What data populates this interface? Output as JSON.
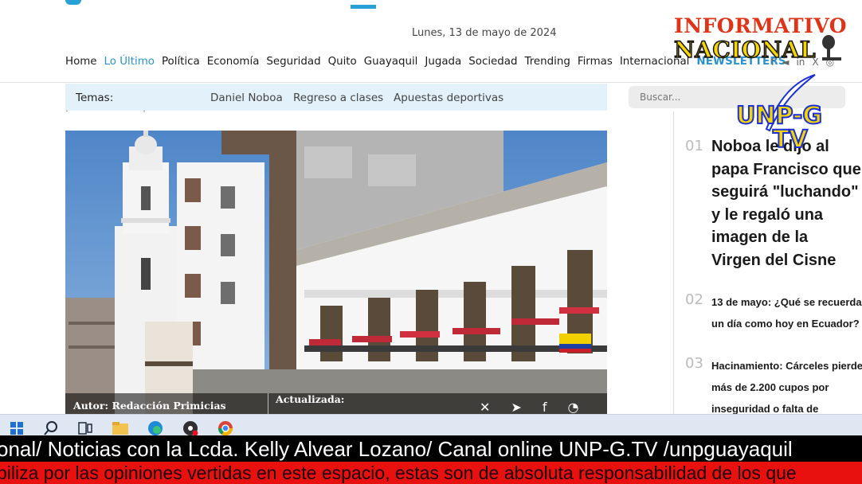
{
  "header": {
    "date": "Lunes, 13 de mayo de 2024"
  },
  "nav": {
    "items": [
      "Home",
      "Lo Último",
      "Política",
      "Economía",
      "Seguridad",
      "Quito",
      "Guayaquil",
      "Jugada",
      "Sociedad",
      "Trending",
      "Firmas",
      "Internacional"
    ],
    "active": "Lo Último",
    "newsletter": "NEWSLETTERS",
    "social_icons": [
      "f",
      "◄",
      "in",
      "X",
      "◎"
    ]
  },
  "temas": {
    "label": "Temas:",
    "links": [
      "Daniel Noboa",
      "Regreso a clases",
      "Apuestas deportivas"
    ]
  },
  "search": {
    "placeholder": "Buscar..."
  },
  "article": {
    "cut_text": "procesos independentistas en América del Sur",
    "author": "Autor: Redacción Primicias",
    "updated": "Actualizada:"
  },
  "sidebar": {
    "stories": [
      {
        "rank": "01",
        "text": "Noboa le dijo al\npapa Francisco que\nseguirá \"luchando\"\ny le regaló una\nimagen de la\nVirgen del Cisne"
      },
      {
        "rank": "02",
        "text": "13 de mayo: ¿Qué se recuerda\nun día como hoy en Ecuador?"
      },
      {
        "rank": "03",
        "text": "Hacinamiento: Cárceles pierden\nmás de 2.200 cupos por\ninseguridad o falta de"
      }
    ]
  },
  "overlay": {
    "brand_top": "INFORMATIVO",
    "brand_bottom": "NACIONAL",
    "channel_top": "UNP-G",
    "channel_bottom": "TV"
  },
  "ticker": {
    "line1": "onal/ Noticias con la Lcda. Kelly Alvear Lozano/ Canal online UNP-G.TV /unpguayaquil",
    "line2": "biliza por las opiniones vertidas en este espacio, estas son de absoluta responsabilidad de los que"
  },
  "taskbar": {
    "icons": [
      "windows-icon",
      "search-icon",
      "task-view-icon",
      "file-explorer-icon",
      "edge-icon",
      "obs-icon",
      "chrome-icon"
    ]
  },
  "colors": {
    "accent": "#2a93cf",
    "temas_bg": "#e3f1fa",
    "ticker_black": "#000000",
    "ticker_red": "#e8110f"
  }
}
